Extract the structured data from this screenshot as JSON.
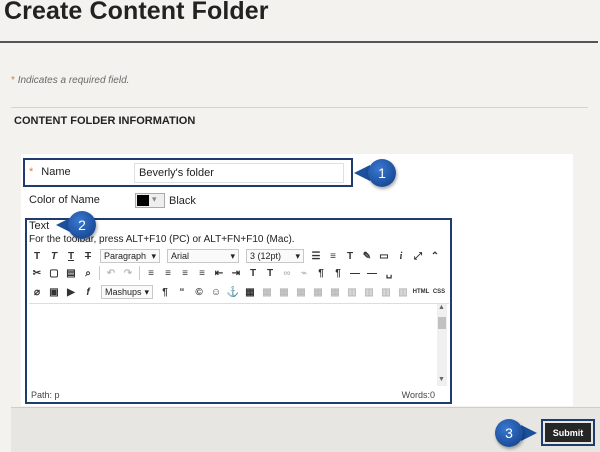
{
  "page": {
    "title": "Create Content Folder",
    "required_note": "Indicates a required field.",
    "required_star": "*"
  },
  "section": {
    "title": "CONTENT FOLDER INFORMATION"
  },
  "form": {
    "name_label": "Name",
    "name_value": "Beverly's folder",
    "color_label": "Color of Name",
    "color_value": "Black",
    "color_swatch": "#000000",
    "text_label": "Text",
    "toolbar_hint": "For the toolbar, press ALT+F10 (PC) or ALT+FN+F10 (Mac)."
  },
  "editor": {
    "format_select": "Paragraph",
    "font_select": "Arial",
    "size_select": "3 (12pt)",
    "mashups_label": "Mashups",
    "html_label": "HTML",
    "css_label": "CSS",
    "path": "Path: p",
    "words": "Words:0"
  },
  "footer": {
    "submit_label": "Submit"
  },
  "callouts": [
    "1",
    "2",
    "3"
  ],
  "colors": {
    "accent_orange": "#e07b39",
    "callout_blue": "#1c4f9c",
    "highlight_border": "#1e3c6e",
    "submit_bg": "#262626"
  }
}
